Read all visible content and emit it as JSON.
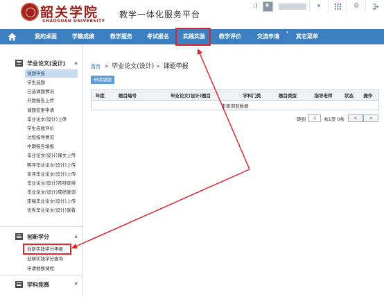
{
  "header": {
    "logo_cn": "韶关学院",
    "logo_en": "SHAOGUAN UNIVERSITY",
    "system_title": "教学一体化服务平台",
    "tool_separator": ":)"
  },
  "nav": {
    "items": [
      "我的桌面",
      "学籍成绩",
      "教学服务",
      "考试报名",
      "实践实验",
      "教学评价",
      "交流申请",
      "其它菜单"
    ]
  },
  "sidebar": {
    "group1": {
      "title": "毕业论文(设计)",
      "items": [
        "课题申报",
        "学生选题",
        "已选课题情况",
        "开题报告上传",
        "课题变更申请",
        "毕业论文(设计)上传",
        "学生自我评价",
        "过程指导情况",
        "中期报告填报",
        "毕业论文(设计)课文上传",
        "明评毕业论文(设计)上传",
        "盲评毕业论文(设计)上传",
        "毕业论文(设计)答辩安排",
        "毕业论文(设计)成绩查询",
        "定稿毕业论文(设计)上传",
        "优秀毕业论文(设计)查看"
      ]
    },
    "group2": {
      "title": "创新学分",
      "items": [
        "创新实践学分申报",
        "创新实践学分查询",
        "申请替换课程"
      ]
    },
    "group3": {
      "title": "学科竞赛"
    }
  },
  "main": {
    "breadcrumb_home": "首页",
    "breadcrumb_sep": "»",
    "breadcrumb_mid": "毕业论文(设计)",
    "breadcrumb_page": "课题申报",
    "apply_button": "申请课题",
    "table": {
      "headers": [
        "年度",
        "题目编号",
        "毕业论文(设计)题目",
        "学科门类",
        "题目类型",
        "指导老师",
        "状态",
        "操作"
      ],
      "empty_text": "未查询到数据"
    },
    "pager": {
      "goto_label": "转到",
      "page_value": "1",
      "summary": "共1页 0条",
      "prev": "<",
      "next": ">"
    }
  },
  "colors": {
    "nav_bg": "#3b7fc0",
    "highlight": "#e0262a",
    "brand": "#9a1d16"
  }
}
